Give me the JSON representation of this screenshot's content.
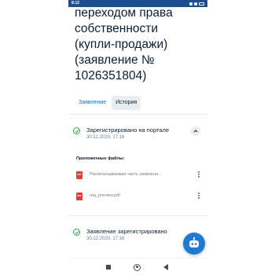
{
  "status_bar": {
    "time": "8:12"
  },
  "header": {
    "title_lines": [
      "переходом права",
      "собственности",
      "(купли-продажи)",
      "(заявление №",
      "1026351804)"
    ]
  },
  "tabs": [
    {
      "label": "Заявление",
      "selected": false
    },
    {
      "label": "История",
      "selected": true
    }
  ],
  "events": [
    {
      "title": "Зарегистрировано на портале",
      "date": "30.12.2020, 17:16",
      "expanded": true
    },
    {
      "title": "Заявление зарегистрировано",
      "date": "30.12.2020, 17:16",
      "expanded": false
    }
  ],
  "attachments": {
    "label": "Приложенные файлы:",
    "files": [
      {
        "icon": "pdf-icon",
        "type_label": "PDF",
        "name": "Распечатываемая часть заявлени..."
      },
      {
        "icon": "pdf-icon",
        "type_label": "PDF",
        "name": "req_preview.pdf"
      }
    ]
  },
  "fab": {
    "icon": "assistant-robot-icon",
    "color": "#1f7ad6"
  },
  "colors": {
    "status_bar": "#1c4d91",
    "accent": "#0b6ec8",
    "success": "#2ba34a",
    "pdf": "#e23d3d"
  }
}
